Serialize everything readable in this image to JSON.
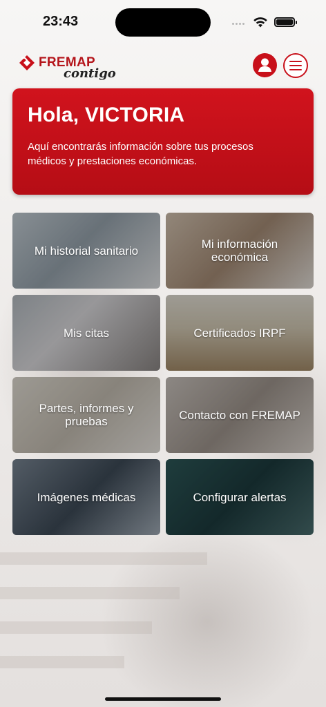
{
  "status_bar": {
    "time": "23:43"
  },
  "header": {
    "logo_text": "FREMAP",
    "logo_tagline": "contigo",
    "profile_icon": "user-icon",
    "menu_icon": "hamburger-icon"
  },
  "greeting": {
    "title": "Hola, VICTORIA",
    "subtitle": "Aquí encontrarás información sobre tus procesos médicos y prestaciones económicas."
  },
  "tiles": [
    {
      "label": "Mi historial sanitario"
    },
    {
      "label": "Mi información económica"
    },
    {
      "label": "Mis citas"
    },
    {
      "label": "Certificados IRPF"
    },
    {
      "label": "Partes, informes y pruebas"
    },
    {
      "label": "Contacto con FREMAP"
    },
    {
      "label": "Imágenes médicas"
    },
    {
      "label": "Configurar alertas"
    }
  ],
  "colors": {
    "brand_red": "#c8101a",
    "card_red": "#d1131d"
  }
}
